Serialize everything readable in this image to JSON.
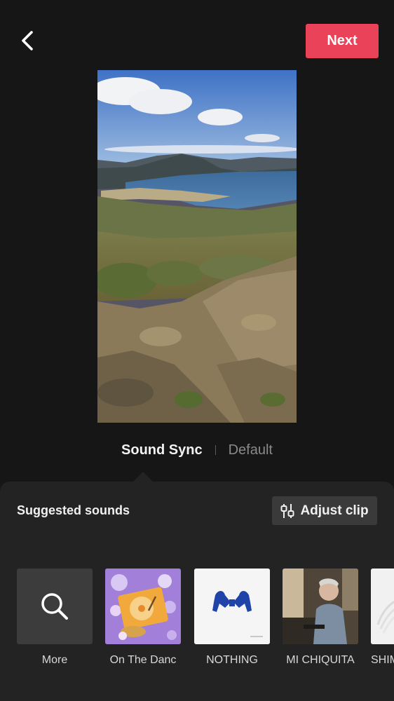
{
  "header": {
    "back_icon": "chevron-left-icon",
    "next_label": "Next",
    "next_color": "#ea4258"
  },
  "preview": {
    "scene": "landscape photo: lake, hills, rocky slope, blue sky"
  },
  "modes": {
    "active_label": "Sound Sync",
    "inactive_label": "Default"
  },
  "sounds_panel": {
    "title": "Suggested sounds",
    "adjust_icon": "sliders-icon",
    "adjust_label": "Adjust clip",
    "items": [
      {
        "label": "More",
        "icon": "search-icon"
      },
      {
        "label": "On The Danc"
      },
      {
        "label": "NOTHING"
      },
      {
        "label": "MI CHIQUITA"
      },
      {
        "label": "SHIM"
      }
    ]
  }
}
